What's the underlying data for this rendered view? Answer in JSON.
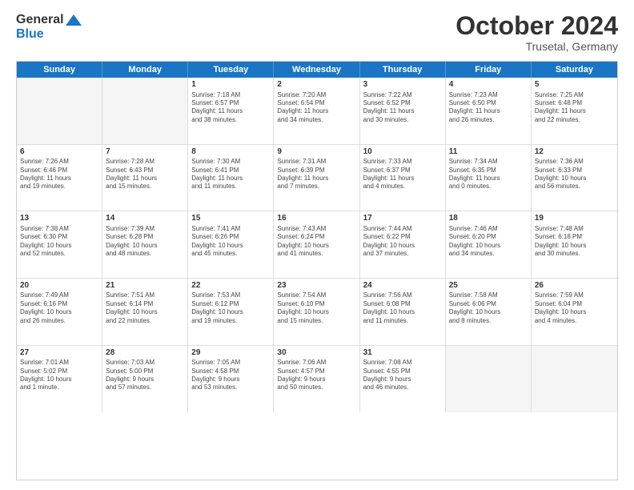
{
  "header": {
    "logo": {
      "line1": "General",
      "line2": "Blue"
    },
    "title": "October 2024",
    "subtitle": "Trusetal, Germany"
  },
  "weekdays": [
    "Sunday",
    "Monday",
    "Tuesday",
    "Wednesday",
    "Thursday",
    "Friday",
    "Saturday"
  ],
  "weeks": [
    [
      {
        "day": "",
        "info": "",
        "empty": true
      },
      {
        "day": "",
        "info": "",
        "empty": true
      },
      {
        "day": "1",
        "info": "Sunrise: 7:18 AM\nSunset: 6:57 PM\nDaylight: 11 hours\nand 38 minutes."
      },
      {
        "day": "2",
        "info": "Sunrise: 7:20 AM\nSunset: 6:54 PM\nDaylight: 11 hours\nand 34 minutes."
      },
      {
        "day": "3",
        "info": "Sunrise: 7:22 AM\nSunset: 6:52 PM\nDaylight: 11 hours\nand 30 minutes."
      },
      {
        "day": "4",
        "info": "Sunrise: 7:23 AM\nSunset: 6:50 PM\nDaylight: 11 hours\nand 26 minutes."
      },
      {
        "day": "5",
        "info": "Sunrise: 7:25 AM\nSunset: 6:48 PM\nDaylight: 11 hours\nand 22 minutes."
      }
    ],
    [
      {
        "day": "6",
        "info": "Sunrise: 7:26 AM\nSunset: 6:46 PM\nDaylight: 11 hours\nand 19 minutes."
      },
      {
        "day": "7",
        "info": "Sunrise: 7:28 AM\nSunset: 6:43 PM\nDaylight: 11 hours\nand 15 minutes."
      },
      {
        "day": "8",
        "info": "Sunrise: 7:30 AM\nSunset: 6:41 PM\nDaylight: 11 hours\nand 11 minutes."
      },
      {
        "day": "9",
        "info": "Sunrise: 7:31 AM\nSunset: 6:39 PM\nDaylight: 11 hours\nand 7 minutes."
      },
      {
        "day": "10",
        "info": "Sunrise: 7:33 AM\nSunset: 6:37 PM\nDaylight: 11 hours\nand 4 minutes."
      },
      {
        "day": "11",
        "info": "Sunrise: 7:34 AM\nSunset: 6:35 PM\nDaylight: 11 hours\nand 0 minutes."
      },
      {
        "day": "12",
        "info": "Sunrise: 7:36 AM\nSunset: 6:33 PM\nDaylight: 10 hours\nand 56 minutes."
      }
    ],
    [
      {
        "day": "13",
        "info": "Sunrise: 7:38 AM\nSunset: 6:30 PM\nDaylight: 10 hours\nand 52 minutes."
      },
      {
        "day": "14",
        "info": "Sunrise: 7:39 AM\nSunset: 6:28 PM\nDaylight: 10 hours\nand 48 minutes."
      },
      {
        "day": "15",
        "info": "Sunrise: 7:41 AM\nSunset: 6:26 PM\nDaylight: 10 hours\nand 45 minutes."
      },
      {
        "day": "16",
        "info": "Sunrise: 7:43 AM\nSunset: 6:24 PM\nDaylight: 10 hours\nand 41 minutes."
      },
      {
        "day": "17",
        "info": "Sunrise: 7:44 AM\nSunset: 6:22 PM\nDaylight: 10 hours\nand 37 minutes."
      },
      {
        "day": "18",
        "info": "Sunrise: 7:46 AM\nSunset: 6:20 PM\nDaylight: 10 hours\nand 34 minutes."
      },
      {
        "day": "19",
        "info": "Sunrise: 7:48 AM\nSunset: 6:18 PM\nDaylight: 10 hours\nand 30 minutes."
      }
    ],
    [
      {
        "day": "20",
        "info": "Sunrise: 7:49 AM\nSunset: 6:16 PM\nDaylight: 10 hours\nand 26 minutes."
      },
      {
        "day": "21",
        "info": "Sunrise: 7:51 AM\nSunset: 6:14 PM\nDaylight: 10 hours\nand 22 minutes."
      },
      {
        "day": "22",
        "info": "Sunrise: 7:53 AM\nSunset: 6:12 PM\nDaylight: 10 hours\nand 19 minutes."
      },
      {
        "day": "23",
        "info": "Sunrise: 7:54 AM\nSunset: 6:10 PM\nDaylight: 10 hours\nand 15 minutes."
      },
      {
        "day": "24",
        "info": "Sunrise: 7:56 AM\nSunset: 6:08 PM\nDaylight: 10 hours\nand 11 minutes."
      },
      {
        "day": "25",
        "info": "Sunrise: 7:58 AM\nSunset: 6:06 PM\nDaylight: 10 hours\nand 8 minutes."
      },
      {
        "day": "26",
        "info": "Sunrise: 7:59 AM\nSunset: 6:04 PM\nDaylight: 10 hours\nand 4 minutes."
      }
    ],
    [
      {
        "day": "27",
        "info": "Sunrise: 7:01 AM\nSunset: 5:02 PM\nDaylight: 10 hours\nand 1 minute."
      },
      {
        "day": "28",
        "info": "Sunrise: 7:03 AM\nSunset: 5:00 PM\nDaylight: 9 hours\nand 57 minutes."
      },
      {
        "day": "29",
        "info": "Sunrise: 7:05 AM\nSunset: 4:58 PM\nDaylight: 9 hours\nand 53 minutes."
      },
      {
        "day": "30",
        "info": "Sunrise: 7:06 AM\nSunset: 4:57 PM\nDaylight: 9 hours\nand 50 minutes."
      },
      {
        "day": "31",
        "info": "Sunrise: 7:08 AM\nSunset: 4:55 PM\nDaylight: 9 hours\nand 46 minutes."
      },
      {
        "day": "",
        "info": "",
        "empty": true
      },
      {
        "day": "",
        "info": "",
        "empty": true
      }
    ]
  ]
}
